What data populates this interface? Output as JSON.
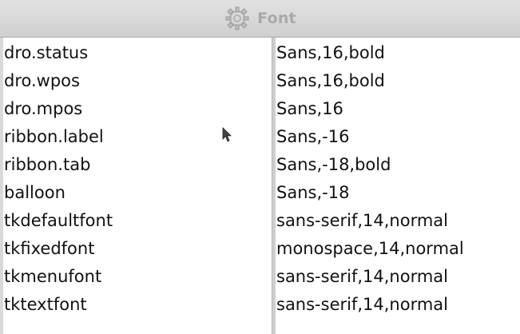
{
  "window": {
    "title": "Font",
    "icon": "gear-icon"
  },
  "fonts": {
    "names": [
      "dro.status",
      "dro.wpos",
      "dro.mpos",
      "ribbon.label",
      "ribbon.tab",
      "balloon",
      "tkdefaultfont",
      "tkfixedfont",
      "tkmenufont",
      "tktextfont"
    ],
    "values": [
      "Sans,16,bold",
      "Sans,16,bold",
      "Sans,16",
      "Sans,-16",
      "Sans,-18,bold",
      "Sans,-18",
      "sans-serif,14,normal",
      "monospace,14,normal",
      "sans-serif,14,normal",
      "sans-serif,14,normal"
    ]
  }
}
